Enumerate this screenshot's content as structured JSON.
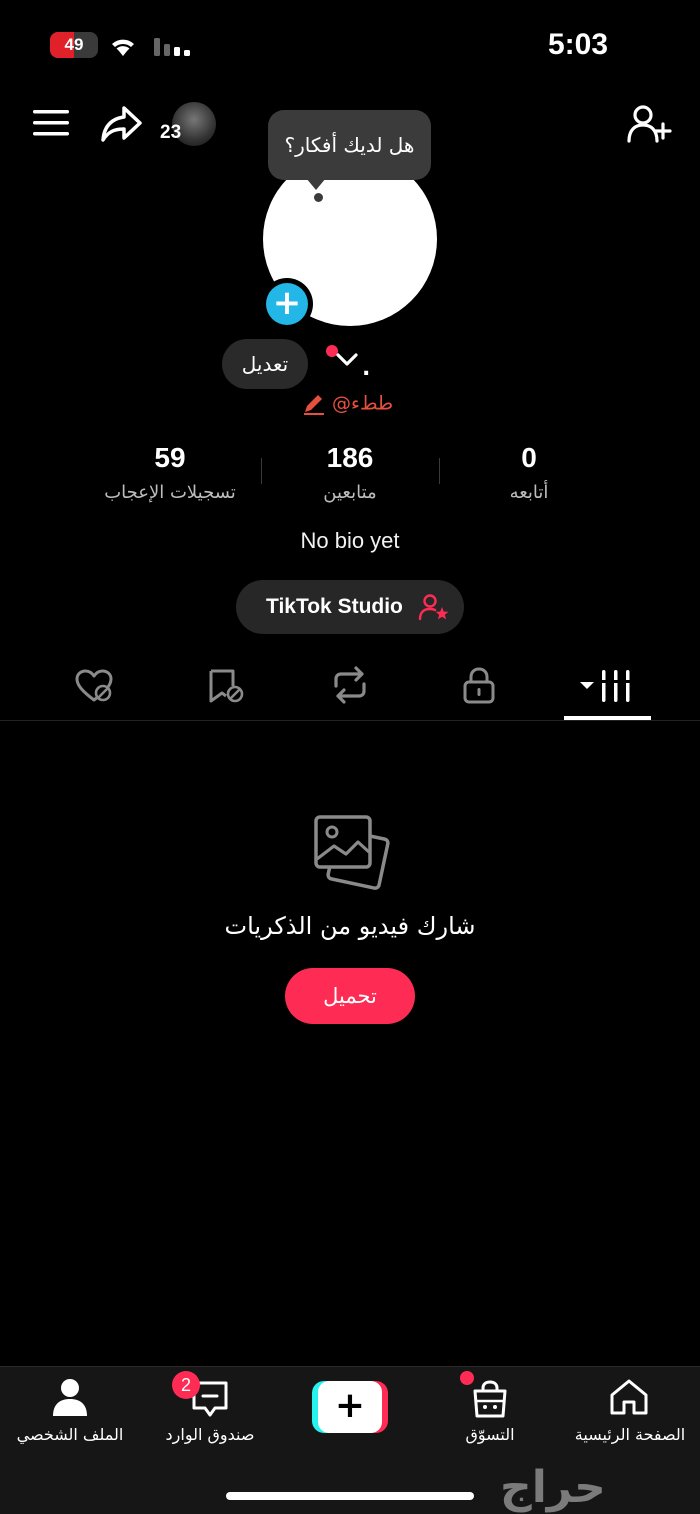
{
  "status_bar": {
    "time": "5:03",
    "battery": "49",
    "battery_level": 0.49
  },
  "top_bar": {
    "avatar_count": "23"
  },
  "tooltip": {
    "text": "هل لديك أفكار؟"
  },
  "profile": {
    "edit_label": "تعديل",
    "name": ".",
    "username": "@ططء"
  },
  "stats": {
    "likes": {
      "value": "59",
      "label": "تسجيلات الإعجاب"
    },
    "followers": {
      "value": "186",
      "label": "متابعين"
    },
    "following": {
      "value": "0",
      "label": "أتابعه"
    }
  },
  "bio": "No bio yet",
  "studio": {
    "label": "TikTok Studio"
  },
  "empty_state": {
    "text": "شارك فيديو من الذكريات",
    "upload_label": "تحميل"
  },
  "bottom_nav": {
    "profile": "الملف الشخصي",
    "inbox": "صندوق الوارد",
    "inbox_badge": "2",
    "shop": "التسوّق",
    "home": "الصفحة الرئيسية"
  },
  "watermark": "حراج",
  "colors": {
    "accent": "#fe2c55",
    "cyan": "#25f4ee",
    "avatar_add": "#22b7e6"
  }
}
